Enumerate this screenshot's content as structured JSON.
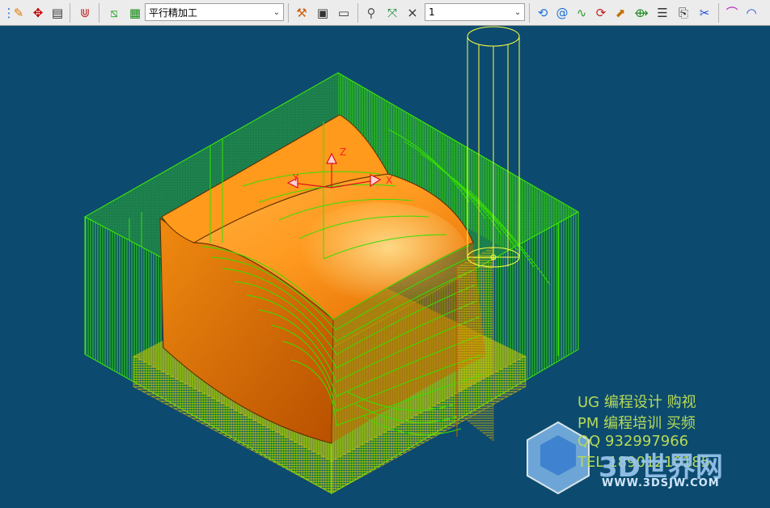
{
  "toolbar": {
    "strategy_select": {
      "value": "平行精加工"
    },
    "tool_select": {
      "value": "1"
    },
    "close_label": "×"
  },
  "watermark": {
    "line1": "UG 编程设计  购视",
    "line2": "PM 编程培训  买频",
    "line3": "QQ  932997966",
    "line4": "TEL 18901210185",
    "logo_text": "3D世界网",
    "logo_url": "WWW.3DSJW.COM"
  },
  "axis_labels": {
    "x": "X",
    "y": "Y",
    "z": "Z"
  },
  "colors": {
    "viewport_bg": "#0c4b6f",
    "toolpath": "#35e000",
    "model": "#f07e0c",
    "tool": "#ffff40",
    "watermark": "#b7d957"
  }
}
